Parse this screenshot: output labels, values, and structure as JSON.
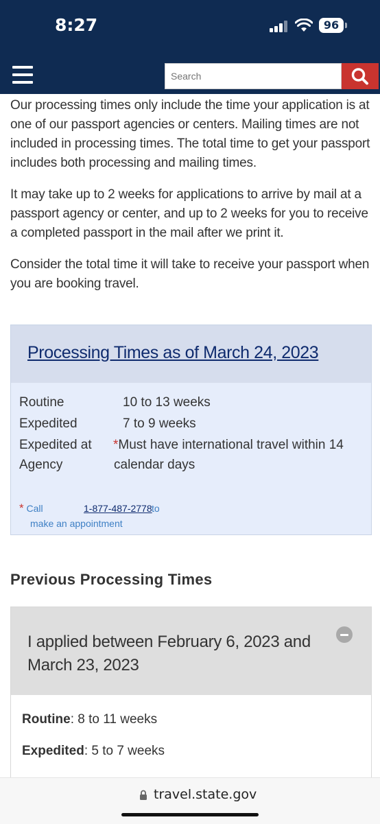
{
  "status_bar": {
    "time": "8:27",
    "battery": "96"
  },
  "header": {
    "search_placeholder": "Search"
  },
  "intro": {
    "p1": "Our processing times only include the time your application is at one of our passport agencies or centers. Mailing times are not included in processing times. The total time to get your passport includes both processing and mailing times.",
    "p2": "It may take up to 2 weeks for applications to arrive by mail at a passport agency or center, and up to 2 weeks for you to receive a completed passport in the mail after we print it.",
    "p3": "Consider the total time it will take to receive your passport when you are booking travel."
  },
  "processing": {
    "title": "Processing Times as of March 24, 2023",
    "rows": [
      {
        "label": "Routine",
        "value": "10 to 13 weeks"
      },
      {
        "label": "Expedited",
        "value": "7 to 9 weeks"
      },
      {
        "label_line1": "Expedited at",
        "label_line2": "Agency",
        "marker": "*",
        "value_line1": "Must have international travel within 14",
        "value_line2": "calendar days"
      }
    ],
    "note": {
      "marker": "*",
      "call": "Call",
      "phone": "1-877-487-2778",
      "to": "to",
      "rest": "make an appointment"
    }
  },
  "previous": {
    "heading": "Previous Processing Times",
    "accordion": {
      "title": "I applied between February 6, 2023 and March 23, 2023",
      "lines": [
        {
          "label": "Routine",
          "value": ": 8 to 11 weeks"
        },
        {
          "label": "Expedited",
          "value": ": 5 to 7 weeks"
        }
      ]
    }
  },
  "browser": {
    "url": "travel.state.gov"
  },
  "colors": {
    "header_bg": "#0f2b52",
    "search_button": "#c9342f",
    "link": "#0f2b6e",
    "note_blue": "#3d7fc4",
    "box_bg": "#e6edfb"
  }
}
